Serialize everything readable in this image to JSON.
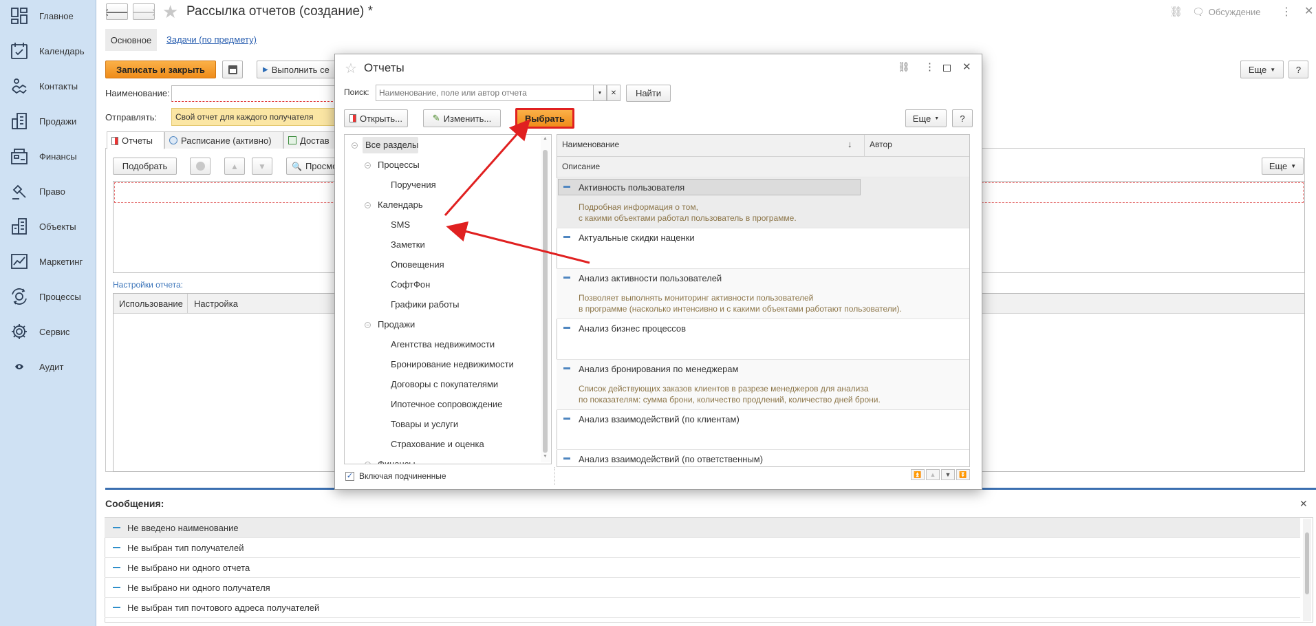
{
  "nav": {
    "items": [
      {
        "label": "Главное",
        "icon": "home-grid-icon"
      },
      {
        "label": "Календарь",
        "icon": "calendar-icon"
      },
      {
        "label": "Контакты",
        "icon": "contacts-icon"
      },
      {
        "label": "Продажи",
        "icon": "sales-icon"
      },
      {
        "label": "Финансы",
        "icon": "finance-icon"
      },
      {
        "label": "Право",
        "icon": "law-icon"
      },
      {
        "label": "Объекты",
        "icon": "buildings-icon"
      },
      {
        "label": "Маркетинг",
        "icon": "marketing-chart-icon"
      },
      {
        "label": "Процессы",
        "icon": "processes-icon"
      },
      {
        "label": "Сервис",
        "icon": "gear-icon"
      },
      {
        "label": "Аудит",
        "icon": "eye-icon"
      }
    ]
  },
  "header": {
    "title": "Рассылка отчетов (создание) *",
    "discussion": "Обсуждение"
  },
  "form": {
    "tabs": {
      "main": "Основное",
      "tasks": "Задачи (по предмету)"
    },
    "toolbar": {
      "save_close": "Записать и закрыть",
      "execute": "Выполнить се",
      "more": "Еще",
      "help": "?"
    },
    "name_label": "Наименование:",
    "name_value": "",
    "send_label": "Отправлять:",
    "send_value": "Свой отчет для каждого получателя",
    "inner_tabs": {
      "reports": "Отчеты",
      "schedule": "Расписание (активно)",
      "delivery": "Достав"
    },
    "inner_toolbar": {
      "pick": "Подобрать",
      "preview": "Просмо",
      "more": "Еще"
    },
    "settings_link": "Настройки отчета:",
    "settings_columns": {
      "usage": "Использование",
      "setting": "Настройка"
    }
  },
  "messages": {
    "title": "Сообщения:",
    "items": [
      "Не введено наименование",
      "Не выбран тип получателей",
      "Не выбрано ни одного отчета",
      "Не выбрано ни одного получателя",
      "Не выбран тип почтового адреса получателей"
    ]
  },
  "dialog": {
    "title": "Отчеты",
    "search_label": "Поиск:",
    "search_placeholder": "Наименование, поле или автор отчета",
    "find": "Найти",
    "open": "Открыть...",
    "edit": "Изменить...",
    "select": "Выбрать",
    "more": "Еще",
    "help": "?",
    "include_sub": "Включая подчиненные",
    "tree": [
      {
        "label": "Все разделы",
        "level": 0,
        "toggle": "−"
      },
      {
        "label": "Процессы",
        "level": 1,
        "toggle": "−"
      },
      {
        "label": "Поручения",
        "level": 2
      },
      {
        "label": "Календарь",
        "level": 1,
        "toggle": "−"
      },
      {
        "label": "SMS",
        "level": 2
      },
      {
        "label": "Заметки",
        "level": 2
      },
      {
        "label": "Оповещения",
        "level": 2
      },
      {
        "label": "СофтФон",
        "level": 2
      },
      {
        "label": "Графики работы",
        "level": 2
      },
      {
        "label": "Продажи",
        "level": 1,
        "toggle": "−"
      },
      {
        "label": "Агентства недвижимости",
        "level": 2
      },
      {
        "label": "Бронирование недвижимости",
        "level": 2
      },
      {
        "label": "Договоры с покупателями",
        "level": 2
      },
      {
        "label": "Ипотечное сопровождение",
        "level": 2
      },
      {
        "label": "Товары и услуги",
        "level": 2
      },
      {
        "label": "Страхование и оценка",
        "level": 2
      },
      {
        "label": "Финансы",
        "level": 1,
        "toggle": "−"
      }
    ],
    "columns": {
      "name": "Наименование",
      "author": "Автор",
      "description": "Описание",
      "sort_arrow": "↓"
    },
    "reports": [
      {
        "title": "Активность пользователя",
        "desc1": "Подробная информация о том,",
        "desc2": "с какими объектами работал пользователь в программе."
      },
      {
        "title": "Актуальные скидки наценки",
        "desc1": "",
        "desc2": ""
      },
      {
        "title": "Анализ активности пользователей",
        "desc1": "Позволяет выполнять мониторинг активности пользователей",
        "desc2": "в программе (насколько интенсивно и с какими объектами работают пользователи)."
      },
      {
        "title": "Анализ бизнес процессов",
        "desc1": "",
        "desc2": ""
      },
      {
        "title": "Анализ бронирования по менеджерам",
        "desc1": "Список действующих заказов клиентов в разрезе менеджеров для анализа",
        "desc2": "по показателям: сумма брони, количество продлений, количество дней брони."
      },
      {
        "title": "Анализ взаимодействий (по клиентам)",
        "desc1": "",
        "desc2": ""
      },
      {
        "title": "Анализ взаимодействий (по ответственным)",
        "desc1": "",
        "desc2": ""
      }
    ]
  },
  "colors": {
    "accent_orange": "#f39c1f",
    "arrow_red": "#e02020",
    "nav_bg": "#cfe1f3",
    "divider_blue": "#3b6fb0"
  }
}
